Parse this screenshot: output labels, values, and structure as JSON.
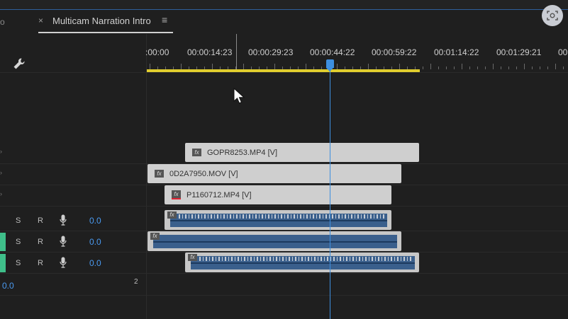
{
  "sequence_tab": {
    "left_edge_text": "o",
    "close_glyph": "×",
    "title": "Multicam Narration Intro",
    "menu_glyph": "≡"
  },
  "ruler": {
    "labels": [
      ":00:00",
      "00:00:14:23",
      "00:00:29:23",
      "00:00:44:22",
      "00:00:59:22",
      "00:01:14:22",
      "00:01:29:21",
      "00:"
    ]
  },
  "video_clips": [
    {
      "name": "GOPR8253.MP4 [V]"
    },
    {
      "name": "0D2A7950.MOV [V]"
    },
    {
      "name": "P1160712.MP4 [V]"
    }
  ],
  "audio_tracks": [
    {
      "solo": "S",
      "record": "R",
      "volume": "0.0"
    },
    {
      "solo": "S",
      "record": "R",
      "volume": "0.0"
    },
    {
      "solo": "S",
      "record": "R",
      "volume": "0.0"
    }
  ],
  "master": {
    "volume": "0.0",
    "channels": "2"
  },
  "fx_label": "fx",
  "icons": {
    "wrench": "wrench-icon",
    "scan": "visual-search-icon",
    "mic": "microphone-icon",
    "cursor": "mouse-pointer-icon"
  },
  "colors": {
    "work_area": "#e0cd2e",
    "playhead": "#3d8fe0",
    "audio_waveform": "#3a5f8c",
    "volume_text": "#4a9af0",
    "track_target": "#3fbf8a"
  }
}
